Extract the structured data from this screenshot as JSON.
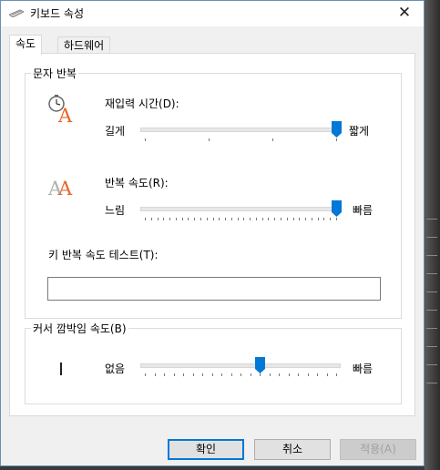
{
  "window": {
    "title": "키보드 속성",
    "close_glyph": "✕"
  },
  "tabs": [
    {
      "label": "속도"
    },
    {
      "label": "하드웨어"
    }
  ],
  "char_repeat": {
    "legend": "문자 반복",
    "delay": {
      "label": "재입력 시간(D):",
      "left": "길게",
      "right": "짧게",
      "value": 1.0
    },
    "rate": {
      "label": "반복 속도(R):",
      "left": "느림",
      "right": "빠름",
      "value": 1.0
    },
    "test": {
      "label": "키 반복 속도 테스트(T):",
      "value": ""
    }
  },
  "cursor_blink": {
    "legend": "커서 깜박임 속도(B)",
    "left": "없음",
    "right": "빠름",
    "value": 0.6
  },
  "buttons": {
    "ok": "확인",
    "cancel": "취소",
    "apply": "적용(A)"
  },
  "colors": {
    "accent": "#0078d7",
    "icon_orange": "#e8662a"
  },
  "icons": {
    "delay_icon": "clock-letter-a-icon",
    "rate_icon": "double-letter-a-icon",
    "cursor_icon": "text-cursor-icon"
  }
}
